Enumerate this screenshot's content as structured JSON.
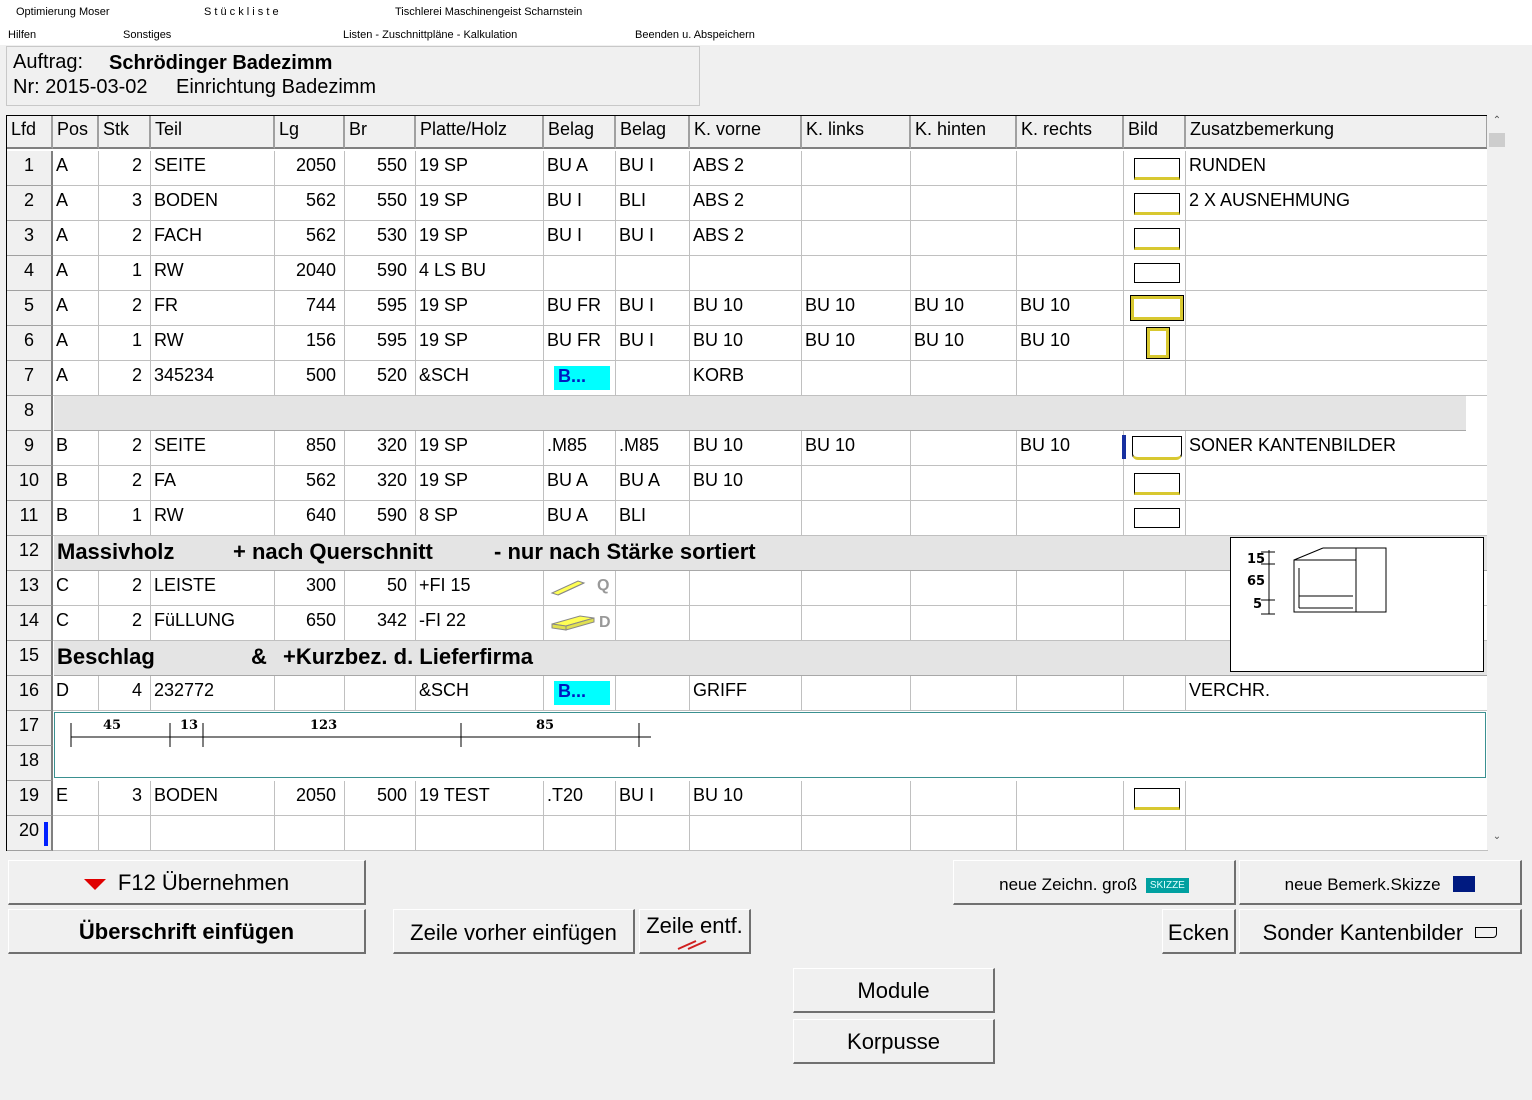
{
  "menu": {
    "row1": [
      "Optimierung Moser",
      "S t ü c k l i s t e",
      "Tischlerei Maschinengeist  Scharnstein"
    ],
    "row2": [
      "Hilfen",
      "Sonstiges",
      "Listen - Zuschnittpläne - Kalkulation",
      "Beenden u. Abspeichern"
    ]
  },
  "header": {
    "auftrag_label": "Auftrag:",
    "auftrag_value": "Schrödinger Badezimm",
    "nr_label": "Nr: 2015-03-02",
    "nr_value": "Einrichtung Badezimm"
  },
  "columns": [
    "Lfd",
    "Pos",
    "Stk",
    "Teil",
    "Lg",
    "Br",
    "Platte/Holz",
    "Belag",
    "Belag",
    "K. vorne",
    "K. links",
    "K. hinten",
    "K. rechts",
    "Bild",
    "Zusatzbemerkung"
  ],
  "rows": [
    {
      "lfd": "1",
      "pos": "A",
      "stk": "2",
      "teil": "SEITE",
      "lg": "2050",
      "br": "550",
      "platte": "19 SP",
      "belag1": "BU A",
      "belag2": "BU I",
      "kv": "ABS 2",
      "kl": "",
      "kh": "",
      "kr": "",
      "bem": "RUNDEN"
    },
    {
      "lfd": "2",
      "pos": "A",
      "stk": "3",
      "teil": "BODEN",
      "lg": "562",
      "br": "550",
      "platte": "19 SP",
      "belag1": "BU I",
      "belag2": "BLI",
      "kv": "ABS 2",
      "kl": "",
      "kh": "",
      "kr": "",
      "bem": "2 X AUSNEHMUNG"
    },
    {
      "lfd": "3",
      "pos": "A",
      "stk": "2",
      "teil": "FACH",
      "lg": "562",
      "br": "530",
      "platte": "19 SP",
      "belag1": "BU I",
      "belag2": "BU I",
      "kv": "ABS 2",
      "kl": "",
      "kh": "",
      "kr": "",
      "bem": ""
    },
    {
      "lfd": "4",
      "pos": "A",
      "stk": "1",
      "teil": "RW",
      "lg": "2040",
      "br": "590",
      "platte": "4 LS BU",
      "belag1": "",
      "belag2": "",
      "kv": "",
      "kl": "",
      "kh": "",
      "kr": "",
      "bem": ""
    },
    {
      "lfd": "5",
      "pos": "A",
      "stk": "2",
      "teil": "FR",
      "lg": "744",
      "br": "595",
      "platte": "19 SP",
      "belag1": "BU FR",
      "belag2": "BU I",
      "kv": "BU 10",
      "kl": "BU 10",
      "kh": "BU 10",
      "kr": "BU 10",
      "bem": ""
    },
    {
      "lfd": "6",
      "pos": "A",
      "stk": "1",
      "teil": "RW",
      "lg": "156",
      "br": "595",
      "platte": "19 SP",
      "belag1": "BU FR",
      "belag2": "BU I",
      "kv": "BU 10",
      "kl": "BU 10",
      "kh": "BU 10",
      "kr": "BU 10",
      "bem": ""
    },
    {
      "lfd": "7",
      "pos": "A",
      "stk": "2",
      "teil": "345234",
      "lg": "500",
      "br": "520",
      "platte": "&SCH",
      "belag1": "",
      "belag2": "",
      "kv": "KORB",
      "kl": "",
      "kh": "",
      "kr": "",
      "bem": ""
    },
    {
      "lfd": "9",
      "pos": "B",
      "stk": "2",
      "teil": "SEITE",
      "lg": "850",
      "br": "320",
      "platte": "19 SP",
      "belag1": ".M85",
      "belag2": ".M85",
      "kv": "BU 10",
      "kl": "BU 10",
      "kh": "",
      "kr": "BU 10",
      "bem": "SONER KANTENBILDER"
    },
    {
      "lfd": "10",
      "pos": "B",
      "stk": "2",
      "teil": "FA",
      "lg": "562",
      "br": "320",
      "platte": "19 SP",
      "belag1": "BU A",
      "belag2": "BU A",
      "kv": "BU 10",
      "kl": "",
      "kh": "",
      "kr": "",
      "bem": ""
    },
    {
      "lfd": "11",
      "pos": "B",
      "stk": "1",
      "teil": "RW",
      "lg": "640",
      "br": "590",
      "platte": "8 SP",
      "belag1": "BU A",
      "belag2": "BLI",
      "kv": "",
      "kl": "",
      "kh": "",
      "kr": "",
      "bem": ""
    },
    {
      "lfd": "13",
      "pos": "C",
      "stk": "2",
      "teil": "LEISTE",
      "lg": "300",
      "br": "50",
      "platte": "+FI 15",
      "belag1": "",
      "belag2": "",
      "kv": "",
      "kl": "",
      "kh": "",
      "kr": "",
      "bem": ""
    },
    {
      "lfd": "14",
      "pos": "C",
      "stk": "2",
      "teil": "FüLLUNG",
      "lg": "650",
      "br": "342",
      "platte": "-FI 22",
      "belag1": "",
      "belag2": "",
      "kv": "",
      "kl": "",
      "kh": "",
      "kr": "",
      "bem": ""
    },
    {
      "lfd": "16",
      "pos": "D",
      "stk": "4",
      "teil": "232772",
      "lg": "",
      "br": "",
      "platte": "&SCH",
      "belag1": "",
      "belag2": "",
      "kv": "GRIFF",
      "kl": "",
      "kh": "",
      "kr": "",
      "bem": "VERCHR."
    },
    {
      "lfd": "19",
      "pos": "E",
      "stk": "3",
      "teil": "BODEN",
      "lg": "2050",
      "br": "500",
      "platte": "19 TEST",
      "belag1": ".T20",
      "belag2": "BU I",
      "kv": "BU 10",
      "kl": "",
      "kh": "",
      "kr": "",
      "bem": ""
    }
  ],
  "other_rownums": [
    "8",
    "12",
    "15",
    "17",
    "18",
    "20"
  ],
  "cyan_label": "B...",
  "heading12": {
    "a": "Massivholz",
    "b": "+ nach Querschnitt",
    "c": "- nur nach Stärke  sortiert"
  },
  "heading15": {
    "a": "Beschlag",
    "b": "&",
    "c": "+Kurzbez. d. Lieferfirma"
  },
  "profile_letters": {
    "q": "Q",
    "d": "D"
  },
  "sketch_labels": [
    "15",
    "65",
    "5"
  ],
  "dim_labels": [
    "45",
    "13",
    "123",
    "85"
  ],
  "buttons": {
    "f12": "F12 Übernehmen",
    "ueberschrift": "Überschrift einfügen",
    "zeile_vorher": "Zeile vorher einfügen",
    "zeile_entf": "Zeile entf.",
    "neue_zeichn": "neue Zeichn. groß",
    "skizze_badge": "SKIZZE",
    "neue_bemerk": "neue Bemerk.Skizze",
    "ecken": "Ecken",
    "sonder": "Sonder Kantenbilder",
    "module": "Module",
    "korpusse": "Korpusse"
  }
}
